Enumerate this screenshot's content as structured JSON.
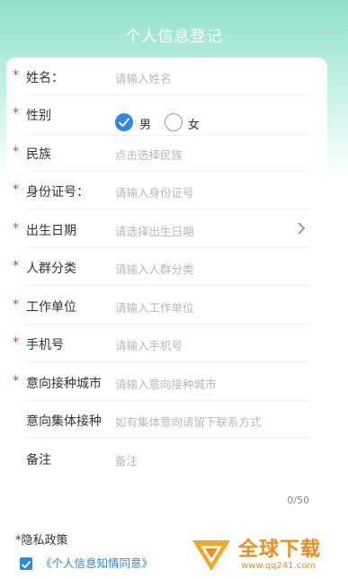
{
  "header": {
    "title": "个人信息登记"
  },
  "form": {
    "fields": [
      {
        "label": "姓名：",
        "required": true,
        "placeholder": "请输入姓名"
      },
      {
        "label": "性别",
        "required": true,
        "options": [
          "男",
          "女"
        ],
        "selected": "男"
      },
      {
        "label": "民族",
        "required": true,
        "placeholder": "点击选择民族"
      },
      {
        "label": "身份证号：",
        "required": true,
        "placeholder": "请输入身份证号"
      },
      {
        "label": "出生日期",
        "required": true,
        "placeholder": "请选择出生日期"
      },
      {
        "label": "人群分类",
        "required": true,
        "placeholder": "请输入人群分类"
      },
      {
        "label": "工作单位",
        "required": true,
        "placeholder": "请输入工作单位"
      },
      {
        "label": "手机号",
        "required": true,
        "placeholder": "请输入手机号"
      },
      {
        "label": "意向接种城市",
        "required": true,
        "placeholder": "请输入意向接种城市"
      },
      {
        "label": "意向集体接种",
        "required": false,
        "placeholder": "如有集体意向请留下联系方式"
      },
      {
        "label": "备注",
        "required": false,
        "placeholder": "备注"
      }
    ],
    "required_mark": "*",
    "remark_counter": "0/50"
  },
  "privacy": {
    "title": "*隐私政策",
    "checked": true,
    "link_text": "《个人信息知情同意》"
  },
  "watermark": {
    "line1": "全球下载",
    "line2": "www.qq241.com"
  },
  "colors": {
    "accent": "#2b86e6",
    "required": "#e23b3b",
    "header_gradient": "#8fe0c8"
  }
}
